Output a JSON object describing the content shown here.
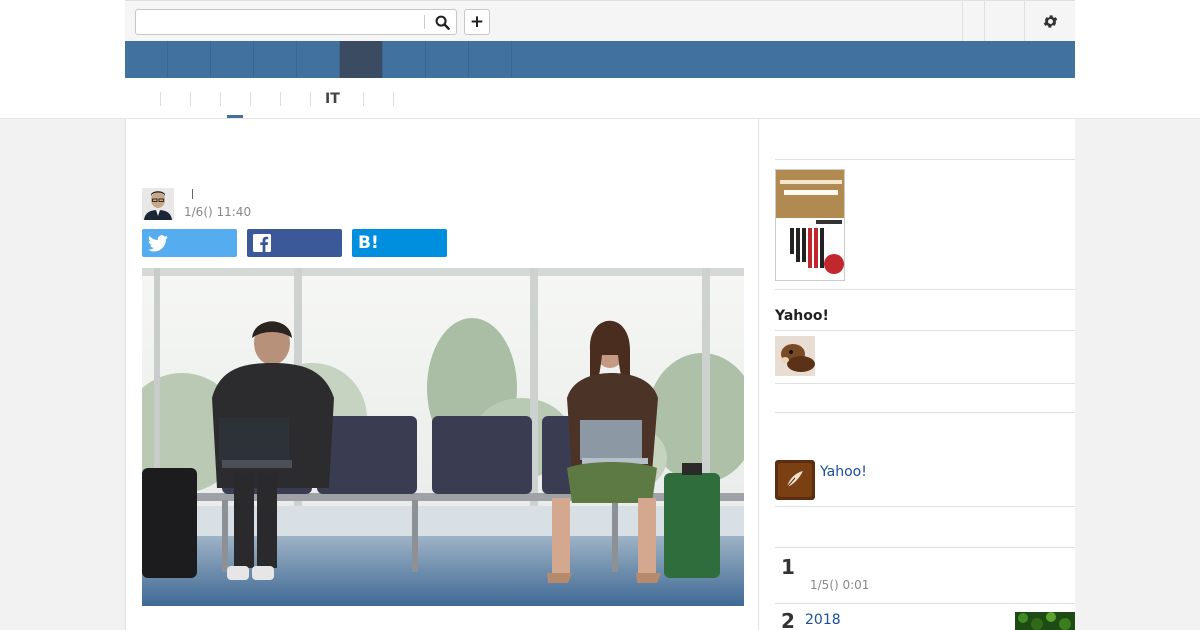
{
  "topbar": {
    "search_placeholder": "",
    "search_icon": "search-icon",
    "plus_label": "+",
    "gear_icon": "gear-icon"
  },
  "nav": {
    "item_count": 9,
    "active_index": 5,
    "bg_color": "#41719f",
    "active_color": "#3b4c62"
  },
  "categories": {
    "labels": [
      "",
      "",
      "",
      "",
      "",
      "IT",
      ""
    ],
    "active_index": 2
  },
  "article": {
    "title": "",
    "author_name": "",
    "date": "1/6() 11:40",
    "share": {
      "twitter_icon": "twitter-icon",
      "facebook_icon": "facebook-icon",
      "hatena_label": "B!"
    },
    "photo_alt": "two-people-with-laptops-in-airport-lounge"
  },
  "sidebar": {
    "heading": "Yahoo!",
    "link_label": "Yahoo!",
    "ranking": [
      {
        "rank": "1",
        "title": "",
        "date": "1/5() 0:01"
      },
      {
        "rank": "2",
        "title": "2018"
      }
    ]
  },
  "colors": {
    "twitter": "#55acee",
    "facebook": "#3b5998",
    "hatena": "#008fde",
    "link": "#1a4f9a"
  }
}
